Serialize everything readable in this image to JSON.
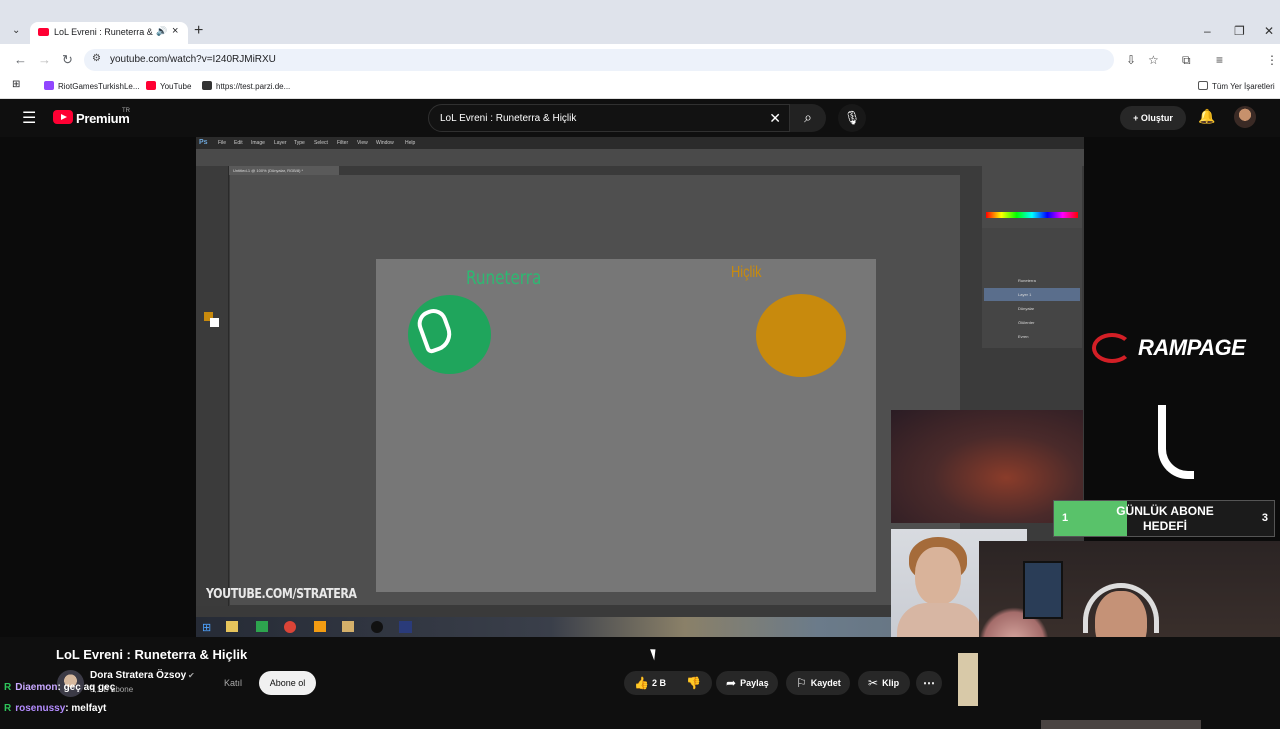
{
  "browser": {
    "tab_title": "LoL Evreni : Runeterra & Hi",
    "tab_audio": "🔊",
    "url": "youtube.com/watch?v=I240RJMiRXU",
    "bookmarks": [
      "RiotGamesTurkishLe...",
      "YouTube",
      "https://test.parzi.de..."
    ],
    "all_bookmarks": "Tüm Yer İşaretleri"
  },
  "youtube": {
    "brand": "Premium",
    "region": "TR",
    "search_query": "LoL Evreni : Runeterra & Hiçlik",
    "create_label": "Oluştur"
  },
  "video": {
    "ps_menu": [
      "File",
      "Edit",
      "Image",
      "Layer",
      "Type",
      "Select",
      "Filter",
      "View",
      "Window",
      "Help"
    ],
    "doc_tab": "Untitled-1 @ 100% (Dünyalar, RGB/8) *",
    "canvas_left_label": "Runeterra",
    "canvas_right_label": "Hiçlik",
    "layers": [
      "Runeterra",
      "Layer 1",
      "Dünyalar",
      "Ölülerder",
      "Evren"
    ],
    "watermark": "YOUTUBE.COM/STRATERA",
    "rampage": "RAMPAGE",
    "goal_title": "GÜNLÜK ABONE HEDEFİ",
    "goal_current": "1",
    "goal_target": "3",
    "goal_progress": 0.333
  },
  "info": {
    "title": "LoL Evreni : Runeterra & Hiçlik",
    "channel": "Dora Stratera Özsoy",
    "subscribers": "3,1 B abone",
    "join_label": "Katıl",
    "subscribe_label": "Abone ol",
    "likes": "2 B",
    "share_label": "Paylaş",
    "save_label": "Kaydet",
    "clip_label": "Klip",
    "more_label": "⋯"
  },
  "chat": [
    {
      "badge": "R",
      "user": "Diaemon",
      "message": ": geç aq geç"
    },
    {
      "badge": "R",
      "user": "rosenussy",
      "message": ": melfayt"
    }
  ],
  "colors": {
    "youtube_red": "#ff0033",
    "runeterra_green": "#1fa55c",
    "hiclik_orange": "#c88a0d",
    "goal_green": "#59c26a",
    "rampage_red": "#d31f26"
  }
}
